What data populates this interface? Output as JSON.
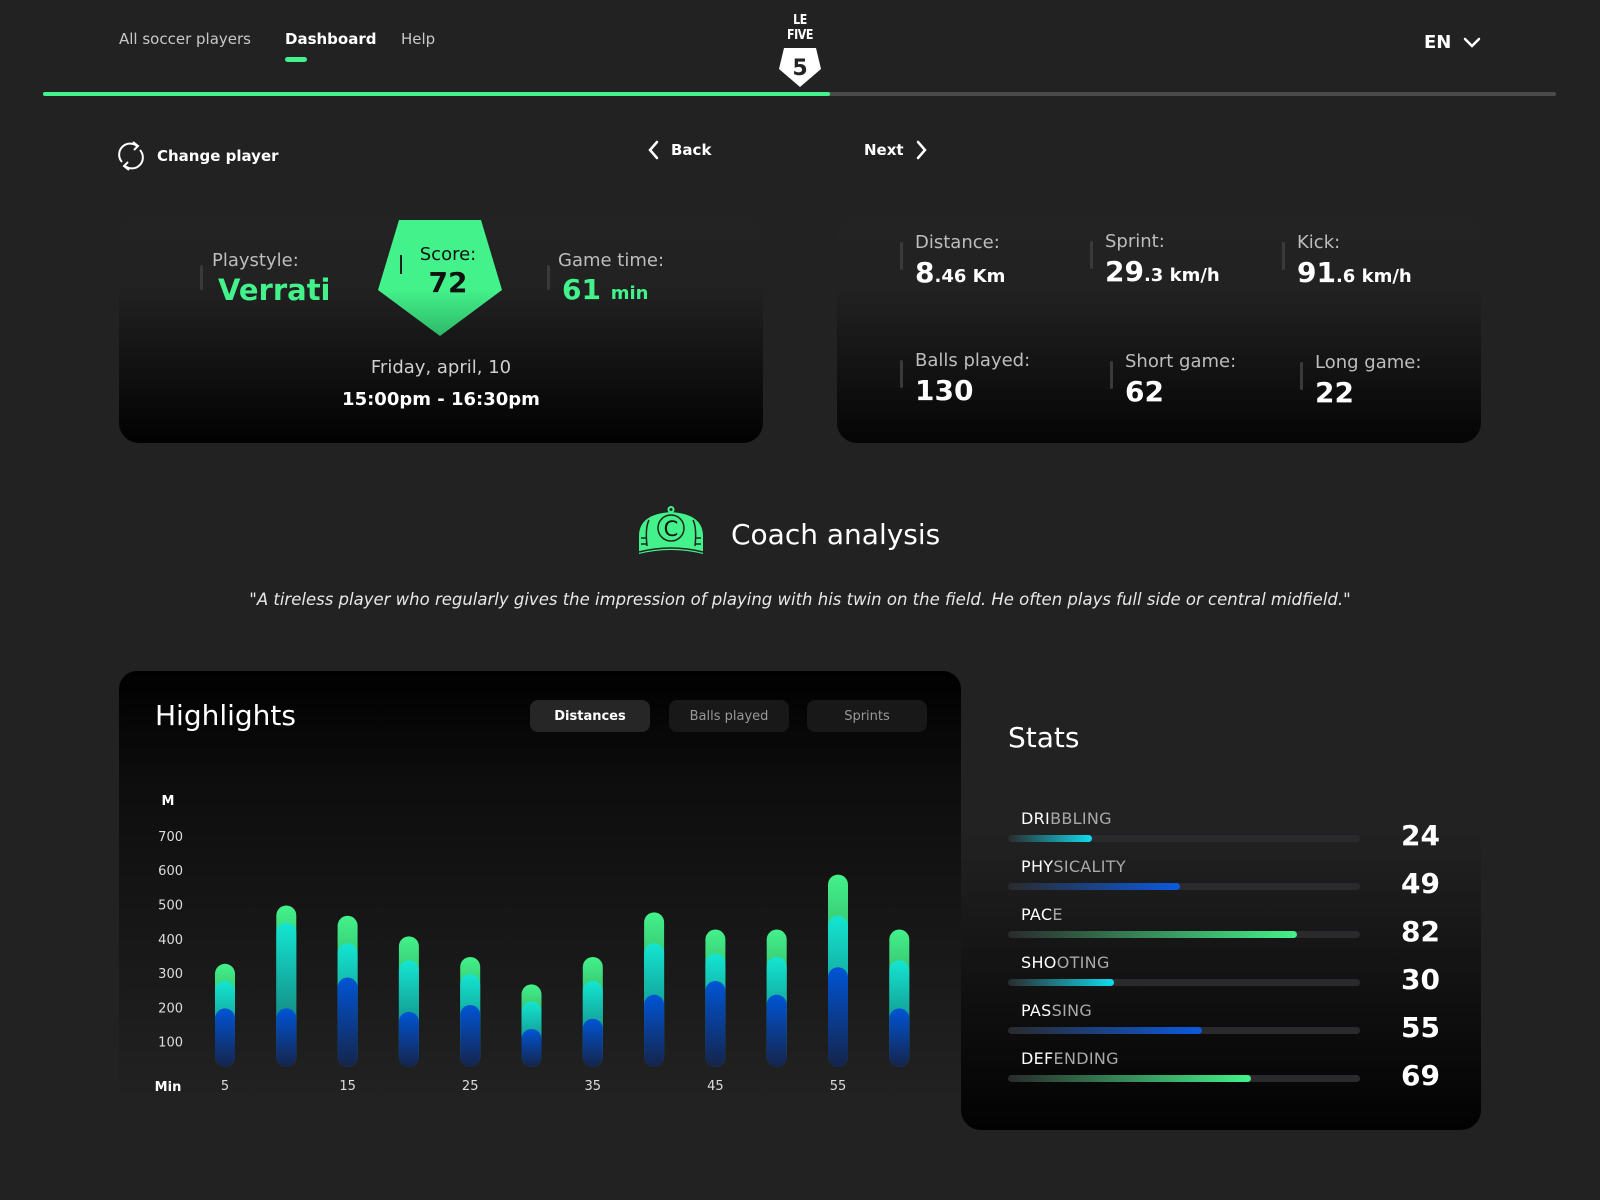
{
  "nav": {
    "links": [
      {
        "label": "All soccer players",
        "active": false
      },
      {
        "label": "Dashboard",
        "active": true
      },
      {
        "label": "Help",
        "active": false
      }
    ],
    "logo_text": "LE FIVE",
    "logo_badge": "5",
    "language": "EN",
    "progress_percent": 52
  },
  "controls": {
    "change_player": "Change player",
    "back": "Back",
    "next": "Next"
  },
  "match": {
    "playstyle_label": "Playstyle:",
    "playstyle_value": "Verrati",
    "score_label": "Score:",
    "score_value": "72",
    "game_time_label": "Game time:",
    "game_time_value": "61",
    "game_time_unit": "min",
    "date": "Friday, april, 10",
    "time_range": "15:00pm - 16:30pm"
  },
  "metrics": [
    {
      "label": "Distance:",
      "int": "8",
      "dec": ".46",
      "unit": "Km"
    },
    {
      "label": "Sprint:",
      "int": "29",
      "dec": ".3",
      "unit": "km/h"
    },
    {
      "label": "Kick:",
      "int": "91",
      "dec": ".6",
      "unit": "km/h"
    },
    {
      "label": "Balls played:",
      "int": "130",
      "dec": "",
      "unit": ""
    },
    {
      "label": "Short game:",
      "int": "62",
      "dec": "",
      "unit": ""
    },
    {
      "label": "Long game:",
      "int": "22",
      "dec": "",
      "unit": ""
    }
  ],
  "coach": {
    "icon": "coach-cap-icon",
    "icon_letter": "C",
    "title": "Coach analysis",
    "quote": "\"A tireless player who regularly gives the impression of playing with his twin on the field. He often plays full side or central midfield.\""
  },
  "highlights": {
    "title": "Highlights",
    "tabs": [
      {
        "label": "Distances",
        "active": true
      },
      {
        "label": "Balls played",
        "active": false
      },
      {
        "label": "Sprints",
        "active": false
      }
    ]
  },
  "chart_data": {
    "type": "bar",
    "title": "Highlights",
    "xlabel": "Min",
    "ylabel": "M",
    "ylim": [
      0,
      700
    ],
    "yticks": [
      100,
      200,
      300,
      400,
      500,
      600,
      700
    ],
    "x_tick_labels": [
      "5",
      "15",
      "25",
      "35",
      "45",
      "55"
    ],
    "x_tick_positions_index": [
      0,
      2,
      4,
      6,
      8,
      10
    ],
    "categories": [
      "5",
      "10",
      "15",
      "20",
      "25",
      "30",
      "35",
      "40",
      "45",
      "50",
      "55",
      "60"
    ],
    "series": [
      {
        "name": "green-layer",
        "color": "#43f28a",
        "values": [
          330,
          500,
          470,
          410,
          350,
          270,
          350,
          480,
          430,
          430,
          590,
          430
        ]
      },
      {
        "name": "cyan-layer",
        "color": "#14e6d2",
        "values": [
          280,
          450,
          390,
          340,
          300,
          220,
          280,
          390,
          360,
          350,
          470,
          340
        ]
      },
      {
        "name": "blue-layer",
        "color": "#0055d6",
        "values": [
          200,
          200,
          290,
          190,
          210,
          140,
          170,
          240,
          280,
          240,
          320,
          200
        ]
      }
    ],
    "grid": false,
    "legend": "none"
  },
  "stats": {
    "title": "Stats",
    "items": [
      {
        "name": "DRIBBLING",
        "highlight": 3,
        "value": 24,
        "color": "#0fdcf0"
      },
      {
        "name": "PHYSICALITY",
        "highlight": 3,
        "value": 49,
        "color": "#0a5ae0"
      },
      {
        "name": "PACE",
        "highlight": 3,
        "value": 82,
        "color": "#43f28a"
      },
      {
        "name": "SHOOTING",
        "highlight": 3,
        "value": 30,
        "color": "#0fdcf0"
      },
      {
        "name": "PASSING",
        "highlight": 3,
        "value": 55,
        "color": "#0a5ae0"
      },
      {
        "name": "DEFENDING",
        "highlight": 3,
        "value": 69,
        "color": "#43f28a"
      }
    ]
  }
}
